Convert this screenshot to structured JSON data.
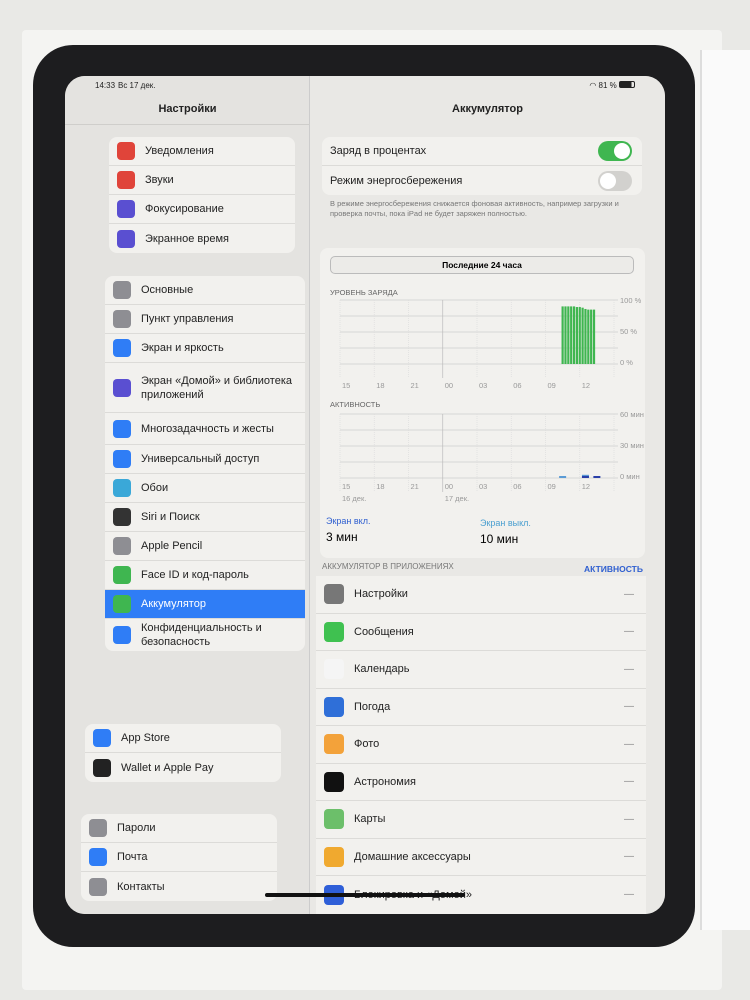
{
  "status_bar": {
    "time": "14:33",
    "date": "Вс 17 дек.",
    "battery": "81 %"
  },
  "sidebar": {
    "title": "Настройки",
    "groups": [
      [
        {
          "label": "Уведомления",
          "icon": "bell-icon",
          "color": "#e0443a"
        },
        {
          "label": "Звуки",
          "icon": "speaker-icon",
          "color": "#e0443a"
        },
        {
          "label": "Фокусирование",
          "icon": "moon-icon",
          "color": "#5a4fd1"
        },
        {
          "label": "Экранное время",
          "icon": "hourglass-icon",
          "color": "#5a4fd1"
        }
      ],
      [
        {
          "label": "Основные",
          "icon": "gear-icon",
          "color": "#8e8e93"
        },
        {
          "label": "Пункт управления",
          "icon": "toggles-icon",
          "color": "#8e8e93"
        },
        {
          "label": "Экран и яркость",
          "icon": "sun-icon",
          "color": "#2f7df6"
        },
        {
          "label": "Экран «Домой» и библиотека приложений",
          "icon": "home-grid-icon",
          "color": "#5a4fd1",
          "lines": 3
        },
        {
          "label": "Многозадачность и жесты",
          "icon": "multitask-icon",
          "color": "#2f7df6",
          "lines": 2
        },
        {
          "label": "Универсальный доступ",
          "icon": "accessibility-icon",
          "color": "#2f7df6"
        },
        {
          "label": "Обои",
          "icon": "flower-icon",
          "color": "#3aa8d8"
        },
        {
          "label": "Siri и Поиск",
          "icon": "siri-icon",
          "color": "#333"
        },
        {
          "label": "Apple Pencil",
          "icon": "pencil-icon",
          "color": "#8e8e93"
        },
        {
          "label": "Face ID и код-пароль",
          "icon": "faceid-icon",
          "color": "#3fb650"
        },
        {
          "label": "Аккумулятор",
          "icon": "battery-icon",
          "color": "#3fb650",
          "selected": true
        },
        {
          "label": "Конфиденциальность и безопасность",
          "icon": "hand-icon",
          "color": "#2f7df6",
          "lines": 2
        }
      ],
      [
        {
          "label": "App Store",
          "icon": "appstore-icon",
          "color": "#2f7df6"
        },
        {
          "label": "Wallet и Apple Pay",
          "icon": "wallet-icon",
          "color": "#222"
        }
      ],
      [
        {
          "label": "Пароли",
          "icon": "key-icon",
          "color": "#8e8e93"
        },
        {
          "label": "Почта",
          "icon": "mail-icon",
          "color": "#2f7df6"
        },
        {
          "label": "Контакты",
          "icon": "contacts-icon",
          "color": "#8e8e93"
        }
      ]
    ]
  },
  "detail": {
    "title": "Аккумулятор",
    "toggles": [
      {
        "label": "Заряд в процентах",
        "on": true
      },
      {
        "label": "Режим энергосбережения",
        "on": false
      }
    ],
    "footnote": "В режиме энергосбережения снижается фоновая активность, например загрузки и проверка почты, пока iPad не будет заряжен полностью.",
    "segment": "Последние 24 часа",
    "battery_label": "УРОВЕНЬ ЗАРЯДА",
    "activity_label": "АКТИВНОСТЬ",
    "battery_y_ticks": [
      "100 %",
      "50 %",
      "0 %"
    ],
    "activity_y_ticks": [
      "60 мин",
      "30 мин",
      "0 мин"
    ],
    "x_ticks": [
      "15",
      "18",
      "21",
      "00",
      "03",
      "06",
      "09",
      "12"
    ],
    "date_labels": [
      "16 дек.",
      "17 дек."
    ],
    "screen_on_label": "Экран вкл.",
    "screen_on_value": "3 мин",
    "screen_off_label": "Экран выкл.",
    "screen_off_value": "10 мин",
    "apps_header": "АККУМУЛЯТОР В ПРИЛОЖЕНИЯХ",
    "apps_action": "АКТИВНОСТЬ",
    "apps": [
      {
        "name": "Настройки",
        "icon": "settings-app-icon",
        "color": "#777",
        "value": "—"
      },
      {
        "name": "Сообщения",
        "icon": "messages-app-icon",
        "color": "#3fc150",
        "value": "—"
      },
      {
        "name": "Календарь",
        "icon": "calendar-app-icon",
        "color": "#f5f5f5",
        "value": "—"
      },
      {
        "name": "Погода",
        "icon": "weather-app-icon",
        "color": "#2f6fd8",
        "value": "—"
      },
      {
        "name": "Фото",
        "icon": "photos-app-icon",
        "color": "#f3a23a",
        "value": "—"
      },
      {
        "name": "Астрономия",
        "icon": "astronomy-app-icon",
        "color": "#111",
        "value": "—"
      },
      {
        "name": "Карты",
        "icon": "maps-app-icon",
        "color": "#6cbf6a",
        "value": "—"
      },
      {
        "name": "Домашние аксессуары",
        "icon": "home-app-icon",
        "color": "#f0a92f",
        "value": "—"
      },
      {
        "name": "Блокировка и «Домой»",
        "icon": "lockscreen-app-icon",
        "color": "#2f5fd8",
        "value": "—"
      }
    ]
  },
  "chart_data": [
    {
      "type": "bar",
      "title": "УРОВЕНЬ ЗАРЯДА",
      "x_unit": "hour",
      "xlim": [
        15,
        39
      ],
      "ylim": [
        0,
        100
      ],
      "color": "#3fb650",
      "x": [
        34.5,
        34.75,
        35,
        35.25,
        35.5,
        35.75,
        36,
        36.25,
        36.5,
        36.75,
        37,
        37.25
      ],
      "values": [
        90,
        90,
        90,
        90,
        90,
        89,
        89,
        88,
        86,
        85,
        85,
        85
      ]
    },
    {
      "type": "bar",
      "title": "АКТИВНОСТЬ",
      "x_unit": "hour",
      "xlim": [
        15,
        39
      ],
      "ylim": [
        0,
        60
      ],
      "series": [
        {
          "x": [
            34.5,
            36.5
          ],
          "values": [
            0.5,
            3
          ],
          "color": "#5b9bd5"
        },
        {
          "x": [
            36.5,
            37.5
          ],
          "values": [
            1,
            1
          ],
          "color": "#2a3fa8"
        }
      ]
    }
  ]
}
